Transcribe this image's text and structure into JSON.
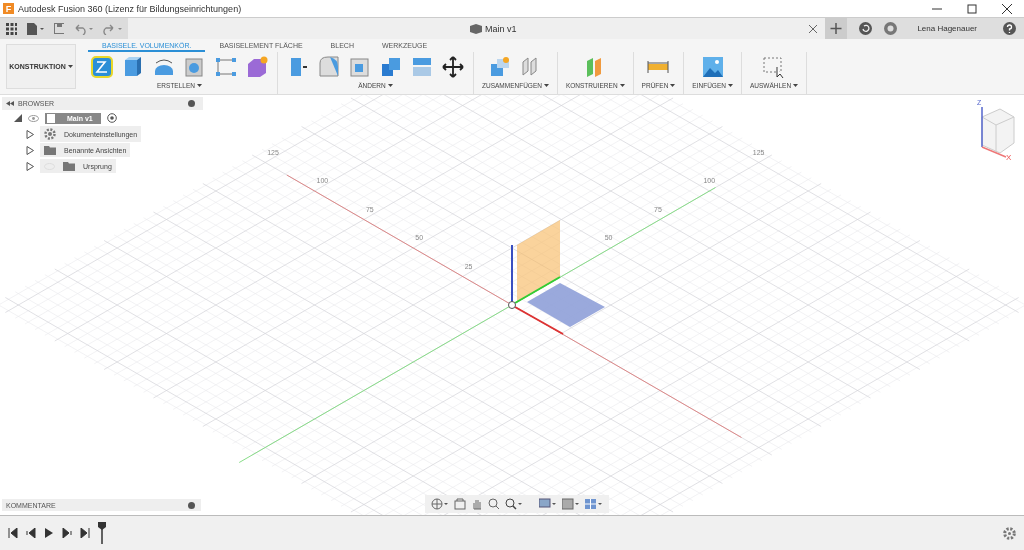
{
  "title_bar": {
    "logo_letter": "F",
    "title": "Autodesk Fusion 360 (Lizenz für Bildungseinrichtungen)"
  },
  "app_bar": {
    "document_tab": "Main v1",
    "user": "Lena Hagenauer"
  },
  "ribbon": {
    "workspace": "KONSTRUKTION",
    "tabs": [
      {
        "label": "BASISELE. VOLUMENKÖR.",
        "selected": true
      },
      {
        "label": "BASISELEMENT FLÄCHE",
        "selected": false
      },
      {
        "label": "BLECH",
        "selected": false
      },
      {
        "label": "WERKZEUGE",
        "selected": false
      }
    ],
    "groups": [
      {
        "label": "ERSTELLEN"
      },
      {
        "label": "ÄNDERN"
      },
      {
        "label": "ZUSAMMENFÜGEN"
      },
      {
        "label": "KONSTRUIEREN"
      },
      {
        "label": "PRÜFEN"
      },
      {
        "label": "EINFÜGEN"
      },
      {
        "label": "AUSWÄHLEN"
      }
    ]
  },
  "browser": {
    "title": "BROWSER",
    "root": {
      "label": "Main v1",
      "expanded": true,
      "children": [
        {
          "label": "Dokumenteinstellungen",
          "kind": "settings",
          "expanded": false
        },
        {
          "label": "Benannte Ansichten",
          "kind": "folder",
          "expanded": false
        },
        {
          "label": "Ursprung",
          "kind": "origin",
          "expanded": false
        }
      ]
    }
  },
  "viewport": {
    "red_axis_labels": [
      "25",
      "50",
      "75",
      "100",
      "125"
    ],
    "green_axis_labels": [
      "50",
      "75",
      "100",
      "125"
    ],
    "view_cube": {
      "z_label": "Z",
      "x_label": "X"
    }
  },
  "comments": {
    "title": "KOMMENTARE"
  }
}
